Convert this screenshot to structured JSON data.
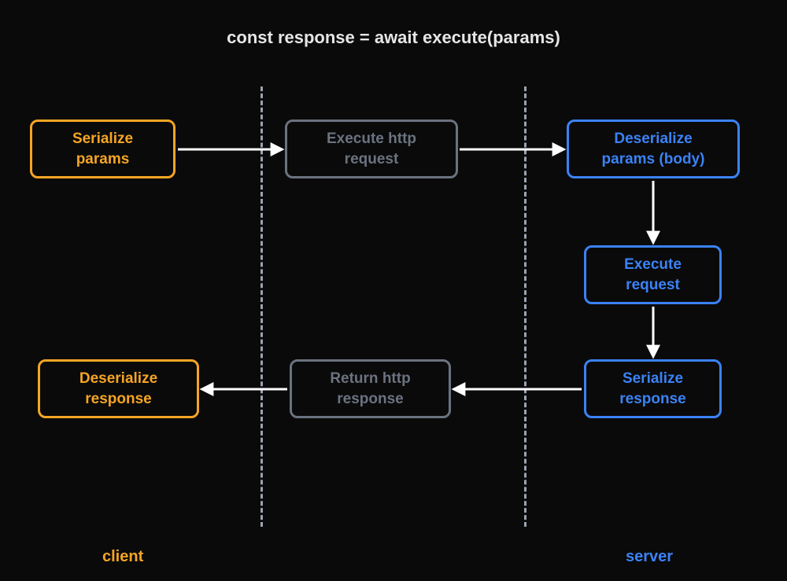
{
  "title": "const response = await execute(params)",
  "labels": {
    "client": "client",
    "server": "server"
  },
  "nodes": {
    "serialize_params": "Serialize\nparams",
    "execute_http_request": "Execute http\nrequest",
    "deserialize_params_body": "Deserialize\nparams (body)",
    "execute_request": "Execute\nrequest",
    "serialize_response": "Serialize\nresponse",
    "return_http_response": "Return http\nresponse",
    "deserialize_response": "Deserialize\nresponse"
  },
  "flow": [
    {
      "from": "serialize_params",
      "to": "execute_http_request",
      "dir": "right"
    },
    {
      "from": "execute_http_request",
      "to": "deserialize_params_body",
      "dir": "right"
    },
    {
      "from": "deserialize_params_body",
      "to": "execute_request",
      "dir": "down"
    },
    {
      "from": "execute_request",
      "to": "serialize_response",
      "dir": "down"
    },
    {
      "from": "serialize_response",
      "to": "return_http_response",
      "dir": "left"
    },
    {
      "from": "return_http_response",
      "to": "deserialize_response",
      "dir": "left"
    }
  ],
  "colors": {
    "client": "#f5a524",
    "transport": "#6b7280",
    "server": "#3b82f6",
    "arrow": "#ffffff",
    "background": "#0a0a0a"
  }
}
